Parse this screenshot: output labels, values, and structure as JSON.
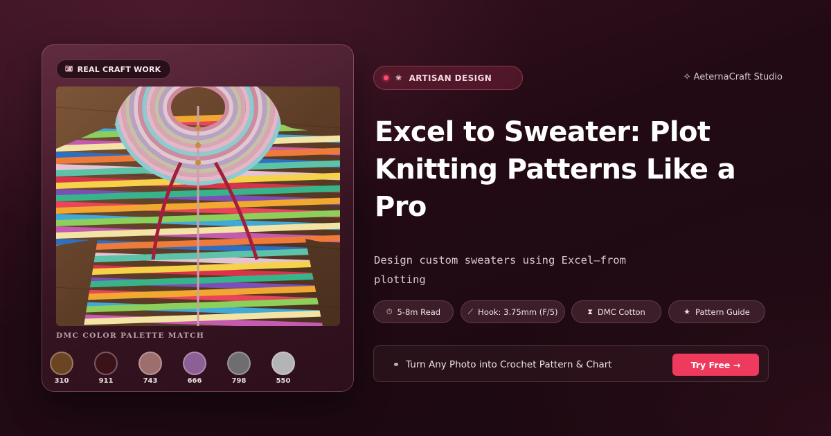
{
  "card": {
    "badge_icon": "camera-icon",
    "badge_label": "REAL CRAFT WORK",
    "photo_name": "crochet-sweater-photo",
    "palette_title": "DMC COLOR PALETTE MATCH",
    "swatches": [
      {
        "code": "310",
        "color": "#6b4423"
      },
      {
        "code": "911",
        "color": "#3c1219"
      },
      {
        "code": "743",
        "color": "#9c6f6d"
      },
      {
        "code": "666",
        "color": "#8c5f96"
      },
      {
        "code": "798",
        "color": "#6e6e70"
      },
      {
        "code": "550",
        "color": "#b4b4b6"
      }
    ]
  },
  "header": {
    "badge_icon": "flower-icon",
    "badge_label": "ARTISAN DESIGN",
    "studio_icon": "sparkle-icon",
    "studio_name": "AeternaCraft Studio"
  },
  "headline": "Excel to Sweater: Plot Knitting Patterns Like a Pro",
  "subtitle": "Design custom sweaters using Excel—from plotting",
  "tags": [
    {
      "icon": "stopwatch-icon",
      "glyph": "⏱",
      "label": "5-8m Read"
    },
    {
      "icon": "hook-icon",
      "glyph": "⟋",
      "label": "Hook: 3.75mm (F/5)"
    },
    {
      "icon": "thread-spool-icon",
      "glyph": "⧗",
      "label": "DMC Cotton"
    },
    {
      "icon": "star-icon",
      "glyph": "★",
      "label": "Pattern Guide"
    }
  ],
  "cta": {
    "icon": "yarn-icon",
    "text": "Turn Any Photo into Crochet Pattern & Chart",
    "button_label": "Try Free →"
  },
  "colors": {
    "accent": "#ee3a5c",
    "background": "#220a14"
  }
}
